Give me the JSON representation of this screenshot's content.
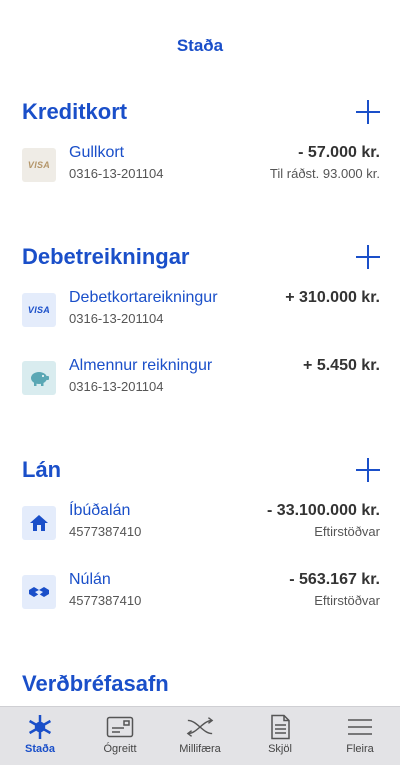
{
  "header": {
    "title": "Staða"
  },
  "sections": {
    "kreditkort": {
      "title": "Kreditkort",
      "rows": [
        {
          "name": "Gullkort",
          "number": "0316-13-201104",
          "amount": "- 57.000 kr.",
          "sub": "Til ráðst. 93.000 kr.",
          "icon_label": "VISA"
        }
      ]
    },
    "debet": {
      "title": "Debetreikningar",
      "rows": [
        {
          "name": "Debetkortareikningur",
          "number": "0316-13-201104",
          "amount": "+ 310.000 kr.",
          "icon_label": "VISA"
        },
        {
          "name": "Almennur reikningur",
          "number": "0316-13-201104",
          "amount": "+ 5.450 kr."
        }
      ]
    },
    "lan": {
      "title": "Lán",
      "rows": [
        {
          "name": "Íbúðalán",
          "number": "4577387410",
          "amount": "- 33.100.000 kr.",
          "sub": "Eftirstöðvar"
        },
        {
          "name": "Núlán",
          "number": "4577387410",
          "amount": "- 563.167 kr.",
          "sub": "Eftirstöðvar"
        }
      ]
    },
    "verdbref": {
      "title": "Verðbréfasafn"
    }
  },
  "tabbar": {
    "items": [
      {
        "label": "Staða",
        "icon": "snowflake-icon",
        "active": true
      },
      {
        "label": "Ógreitt",
        "icon": "bill-icon"
      },
      {
        "label": "Millifæra",
        "icon": "transfer-icon"
      },
      {
        "label": "Skjöl",
        "icon": "document-icon"
      },
      {
        "label": "Fleira",
        "icon": "menu-icon"
      }
    ]
  },
  "colors": {
    "accent": "#1a4fc9",
    "tabbar_bg": "#e3e3e6"
  }
}
